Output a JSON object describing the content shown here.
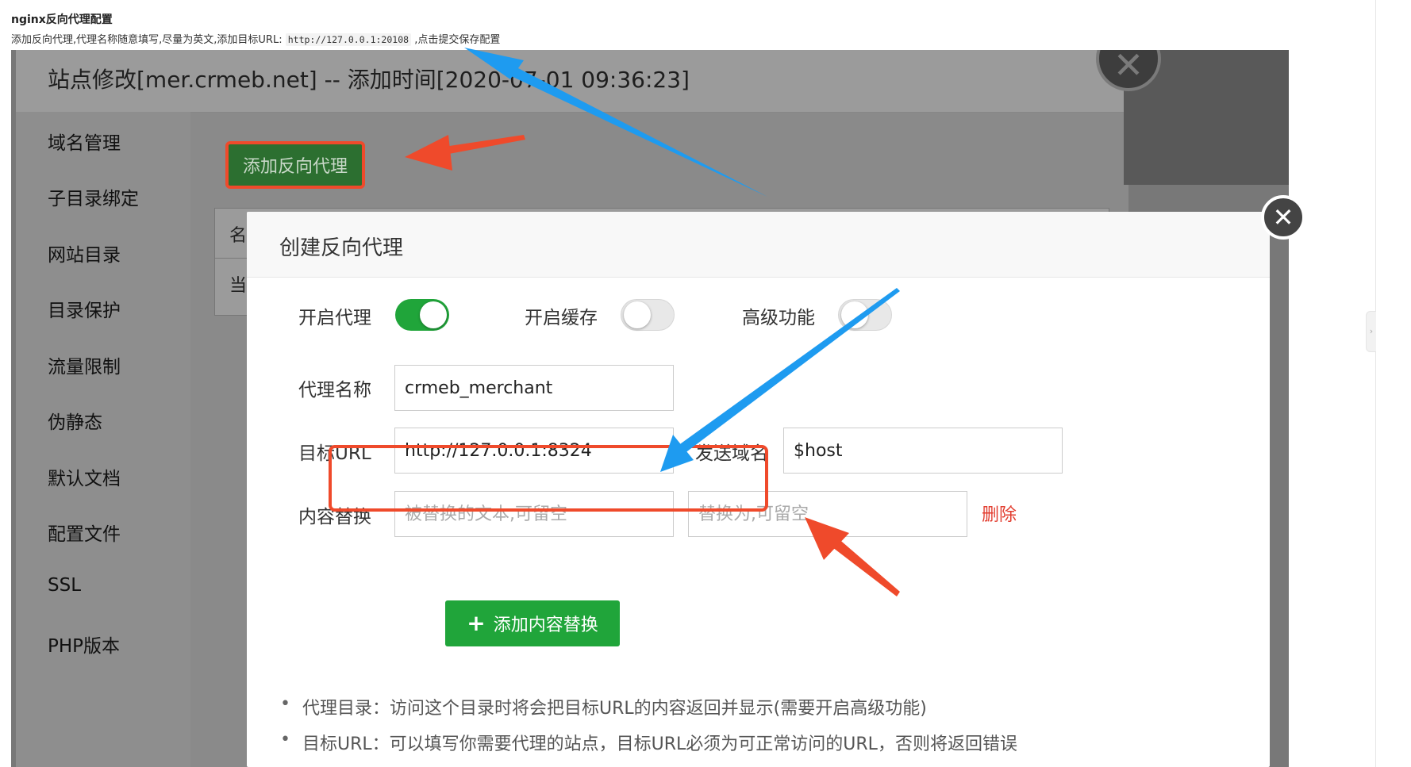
{
  "doc": {
    "title": "nginx反向代理配置",
    "desc_prefix": "添加反向代理,代理名称随意填写,尽量为英文,添加目标URL:",
    "desc_code": "http://127.0.0.1:20108",
    "desc_suffix": ",点击提交保存配置"
  },
  "outer": {
    "title": "站点修改[mer.crmeb.net] -- 添加时间[2020-07-01 09:36:23]",
    "nav": [
      "域名管理",
      "子目录绑定",
      "网站目录",
      "目录保护",
      "流量限制",
      "伪静态",
      "默认文档",
      "配置文件",
      "SSL",
      "PHP版本"
    ],
    "add_proxy_button": "添加反向代理",
    "table_header_stub": "名",
    "table_row_stub": "当",
    "close_glyph": "✕"
  },
  "dialog": {
    "title": "创建反向代理",
    "close_glyph": "✕",
    "toggles": [
      {
        "label": "开启代理",
        "on": true
      },
      {
        "label": "开启缓存",
        "on": false
      },
      {
        "label": "高级功能",
        "on": false
      }
    ],
    "proxy_name_label": "代理名称",
    "proxy_name_value": "crmeb_merchant",
    "target_url_label": "目标URL",
    "target_url_value": "http://127.0.0.1:8324",
    "send_domain_label": "发送域名",
    "send_domain_value": "$host",
    "content_replace_label": "内容替换",
    "replace_from_placeholder": "被替换的文本,可留空",
    "replace_to_placeholder": "替换为,可留空",
    "delete_label": "删除",
    "add_content_button": "添加内容替换",
    "tips": [
      "代理目录：访问这个目录时将会把目标URL的内容返回并显示(需要开启高级功能)",
      "目标URL：可以填写你需要代理的站点，目标URL必须为可正常访问的URL，否则将返回错误"
    ]
  },
  "colors": {
    "accent_green": "#20a53a",
    "annotation_red": "#ef4a2b",
    "annotation_blue": "#1e9bf0",
    "delete_red": "#e23d2f"
  }
}
